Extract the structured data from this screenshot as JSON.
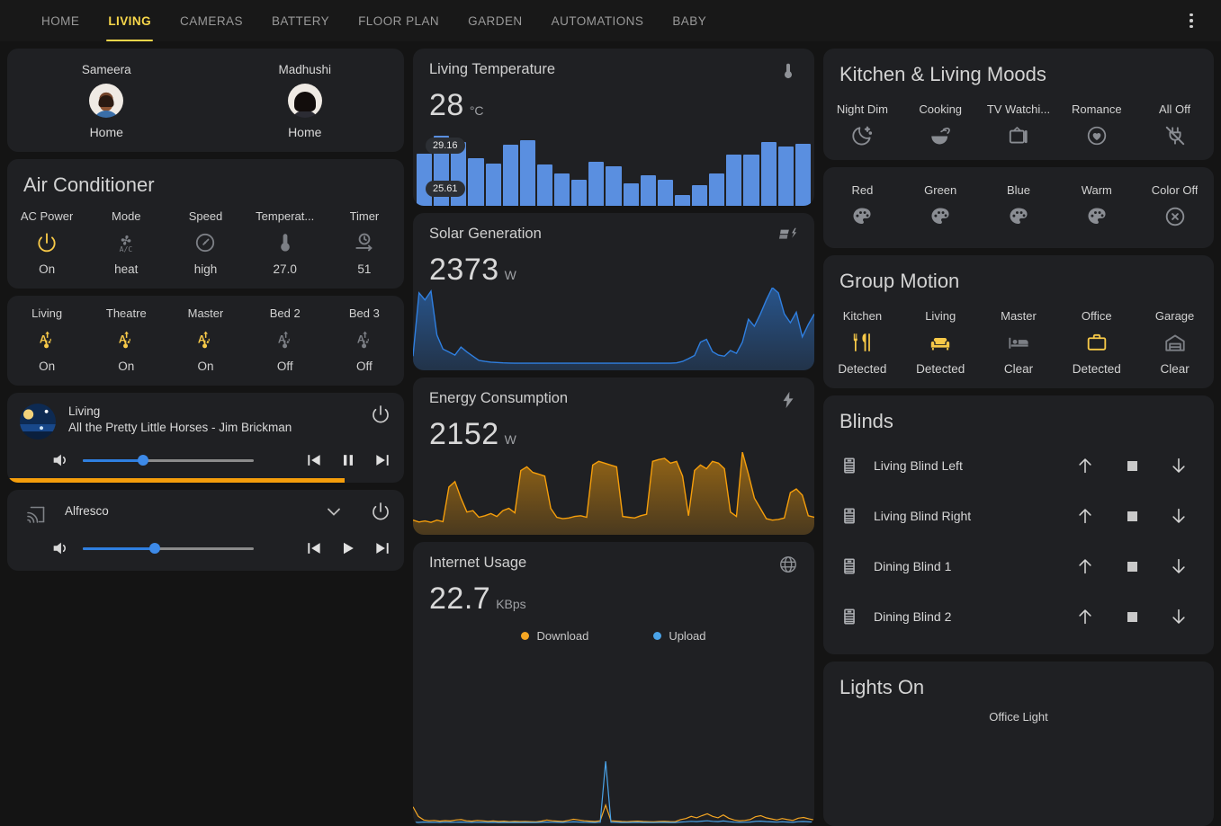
{
  "nav": {
    "tabs": [
      {
        "label": "HOME",
        "active": false
      },
      {
        "label": "LIVING",
        "active": true
      },
      {
        "label": "CAMERAS",
        "active": false
      },
      {
        "label": "BATTERY",
        "active": false
      },
      {
        "label": "FLOOR PLAN",
        "active": false
      },
      {
        "label": "GARDEN",
        "active": false
      },
      {
        "label": "AUTOMATIONS",
        "active": false
      },
      {
        "label": "BABY",
        "active": false
      }
    ],
    "accent": "#f7d64a"
  },
  "persons": [
    {
      "name": "Sameera",
      "state": "Home"
    },
    {
      "name": "Madhushi",
      "state": "Home"
    }
  ],
  "air_conditioner": {
    "title": "Air Conditioner",
    "controls": [
      {
        "label": "AC Power",
        "value": "On",
        "icon": "power-icon",
        "state": "on"
      },
      {
        "label": "Mode",
        "value": "heat",
        "icon": "ac-fan-icon",
        "state": "off"
      },
      {
        "label": "Speed",
        "value": "high",
        "icon": "gauge-icon",
        "state": "off"
      },
      {
        "label": "Temperat...",
        "value": "27.0",
        "icon": "thermometer-icon",
        "state": "off"
      },
      {
        "label": "Timer",
        "value": "51",
        "icon": "timer-icon",
        "state": "off"
      }
    ]
  },
  "room_lights": [
    {
      "label": "Living",
      "value": "On",
      "icon": "adaptive-light-icon",
      "state": "on"
    },
    {
      "label": "Theatre",
      "value": "On",
      "icon": "adaptive-light-icon",
      "state": "on"
    },
    {
      "label": "Master",
      "value": "On",
      "icon": "adaptive-light-icon",
      "state": "on"
    },
    {
      "label": "Bed 2",
      "value": "Off",
      "icon": "adaptive-light-icon",
      "state": "off"
    },
    {
      "label": "Bed 3",
      "value": "Off",
      "icon": "adaptive-light-icon",
      "state": "off"
    }
  ],
  "media_players": [
    {
      "name": "Living",
      "track": "All the Pretty Little Horses - Jim Brickman",
      "volume_percent": 35,
      "progress_percent": 85,
      "playing": true,
      "play_icon": "pause-icon",
      "has_artwork": true
    },
    {
      "name": "Alfresco",
      "track": "",
      "volume_percent": 42,
      "progress_percent": 0,
      "playing": false,
      "play_icon": "play-icon",
      "has_artwork": false
    }
  ],
  "sensors": {
    "temperature": {
      "name": "Living Temperature",
      "value": "28",
      "unit": "°C",
      "icon": "thermometer-icon",
      "max_label": "29.16",
      "min_label": "25.61"
    },
    "solar": {
      "name": "Solar Generation",
      "value": "2373",
      "unit": "W",
      "icon": "solar-power-icon"
    },
    "energy": {
      "name": "Energy Consumption",
      "value": "2152",
      "unit": "W",
      "icon": "lightning-bolt-icon"
    },
    "internet": {
      "name": "Internet Usage",
      "value": "22.7",
      "unit": "KBps",
      "icon": "globe-icon",
      "legend": [
        {
          "label": "Download",
          "color": "#f5a623"
        },
        {
          "label": "Upload",
          "color": "#4aa3e8"
        }
      ]
    }
  },
  "chart_data": [
    {
      "type": "bar",
      "title": "Living Temperature",
      "ylabel": "°C",
      "ylim": [
        25.61,
        29.16
      ],
      "values": [
        28.1,
        29.16,
        28.8,
        27.8,
        27.5,
        28.6,
        28.9,
        27.4,
        26.9,
        26.5,
        27.6,
        27.3,
        26.3,
        26.8,
        26.5,
        25.61,
        26.2,
        26.9,
        28.0,
        28.0,
        28.8,
        28.5,
        28.7
      ],
      "max_label": "29.16",
      "min_label": "25.61",
      "color": "#5a8fe0"
    },
    {
      "type": "area",
      "title": "Solar Generation",
      "ylabel": "W",
      "current": 2373,
      "color": "#2f7fe0",
      "values": [
        300,
        2100,
        1900,
        2150,
        900,
        500,
        420,
        330,
        560,
        420,
        300,
        180,
        150,
        130,
        120,
        110,
        105,
        100,
        100,
        100,
        100,
        100,
        100,
        100,
        100,
        100,
        100,
        100,
        100,
        100,
        100,
        100,
        100,
        100,
        100,
        100,
        100,
        100,
        100,
        100,
        100,
        100,
        100,
        100,
        110,
        150,
        230,
        320,
        700,
        780,
        430,
        330,
        300,
        460,
        380,
        700,
        1350,
        1150,
        1500,
        1900,
        2250,
        2100,
        1500,
        1250,
        1550,
        850,
        1200,
        1500
      ]
    },
    {
      "type": "area",
      "title": "Energy Consumption",
      "ylabel": "W",
      "current": 2152,
      "color": "#f59e0b",
      "values": [
        300,
        250,
        280,
        240,
        300,
        260,
        1200,
        1350,
        900,
        520,
        560,
        380,
        420,
        480,
        400,
        560,
        620,
        500,
        1650,
        1750,
        1600,
        1550,
        1500,
        620,
        380,
        340,
        360,
        400,
        420,
        380,
        1800,
        1900,
        1850,
        1800,
        1750,
        400,
        380,
        360,
        420,
        460,
        1900,
        1950,
        1980,
        1850,
        1900,
        1500,
        420,
        1650,
        1800,
        1700,
        1900,
        1850,
        1700,
        520,
        400,
        2152,
        1550,
        900,
        620,
        340,
        300,
        320,
        360,
        1050,
        1150,
        980,
        420,
        380
      ]
    },
    {
      "type": "line",
      "title": "Internet Usage",
      "ylabel": "KBps",
      "current": 22.7,
      "series": [
        {
          "name": "Download",
          "color": "#f5a623",
          "values": [
            900,
            380,
            180,
            140,
            160,
            120,
            150,
            130,
            180,
            200,
            140,
            120,
            160,
            140,
            110,
            130,
            100,
            120,
            90,
            110,
            95,
            100,
            90,
            85,
            120,
            180,
            140,
            120,
            100,
            160,
            220,
            180,
            140,
            120,
            100,
            140,
            1000,
            140,
            120,
            100,
            90,
            110,
            120,
            100,
            90,
            80,
            100,
            110,
            95,
            90,
            200,
            260,
            380,
            300,
            420,
            520,
            380,
            300,
            460,
            280,
            180,
            140,
            160,
            200,
            360,
            420,
            300,
            240,
            180,
            260,
            200,
            160,
            280,
            320,
            240,
            180
          ]
        },
        {
          "name": "Upload",
          "color": "#4aa3e8",
          "values": [
            60,
            50,
            70,
            55,
            60,
            50,
            65,
            55,
            60,
            70,
            55,
            50,
            60,
            55,
            50,
            55,
            45,
            50,
            45,
            50,
            45,
            48,
            45,
            42,
            55,
            70,
            58,
            52,
            48,
            62,
            80,
            68,
            56,
            50,
            46,
            58,
            3400,
            58,
            52,
            46,
            44,
            50,
            52,
            46,
            44,
            40,
            48,
            50,
            45,
            44,
            70,
            85,
            110,
            95,
            120,
            140,
            110,
            95,
            130,
            90,
            62,
            55,
            60,
            70,
            105,
            120,
            92,
            78,
            62,
            82,
            68,
            56,
            88,
            98,
            78,
            62
          ]
        }
      ]
    }
  ],
  "moods": {
    "title": "Kitchen & Living Moods",
    "scenes": [
      {
        "label": "Night Dim",
        "icon": "moon-stars-icon"
      },
      {
        "label": "Cooking",
        "icon": "bowl-icon"
      },
      {
        "label": "TV Watchi...",
        "icon": "television-icon"
      },
      {
        "label": "Romance",
        "icon": "heart-circle-icon"
      },
      {
        "label": "All Off",
        "icon": "power-plug-off-icon"
      }
    ]
  },
  "colors": {
    "scenes": [
      {
        "label": "Red",
        "icon": "palette-icon"
      },
      {
        "label": "Green",
        "icon": "palette-icon"
      },
      {
        "label": "Blue",
        "icon": "palette-icon"
      },
      {
        "label": "Warm",
        "icon": "palette-icon"
      },
      {
        "label": "Color Off",
        "icon": "close-circle-icon"
      }
    ]
  },
  "group_motion": {
    "title": "Group Motion",
    "zones": [
      {
        "label": "Kitchen",
        "value": "Detected",
        "icon": "cutlery-icon",
        "state": "on"
      },
      {
        "label": "Living",
        "value": "Detected",
        "icon": "sofa-icon",
        "state": "on"
      },
      {
        "label": "Master",
        "value": "Clear",
        "icon": "bed-icon",
        "state": "off"
      },
      {
        "label": "Office",
        "value": "Detected",
        "icon": "briefcase-icon",
        "state": "on"
      },
      {
        "label": "Garage",
        "value": "Clear",
        "icon": "garage-icon",
        "state": "off"
      }
    ]
  },
  "blinds": {
    "title": "Blinds",
    "items": [
      {
        "name": "Living Blind Left"
      },
      {
        "name": "Living Blind Right"
      },
      {
        "name": "Dining Blind 1"
      },
      {
        "name": "Dining Blind 2"
      }
    ],
    "controls": {
      "up": "arrow-up-icon",
      "stop": "stop-icon",
      "down": "arrow-down-icon"
    }
  },
  "lights_on": {
    "title": "Lights On",
    "items": [
      {
        "label": "Office Light"
      }
    ]
  }
}
